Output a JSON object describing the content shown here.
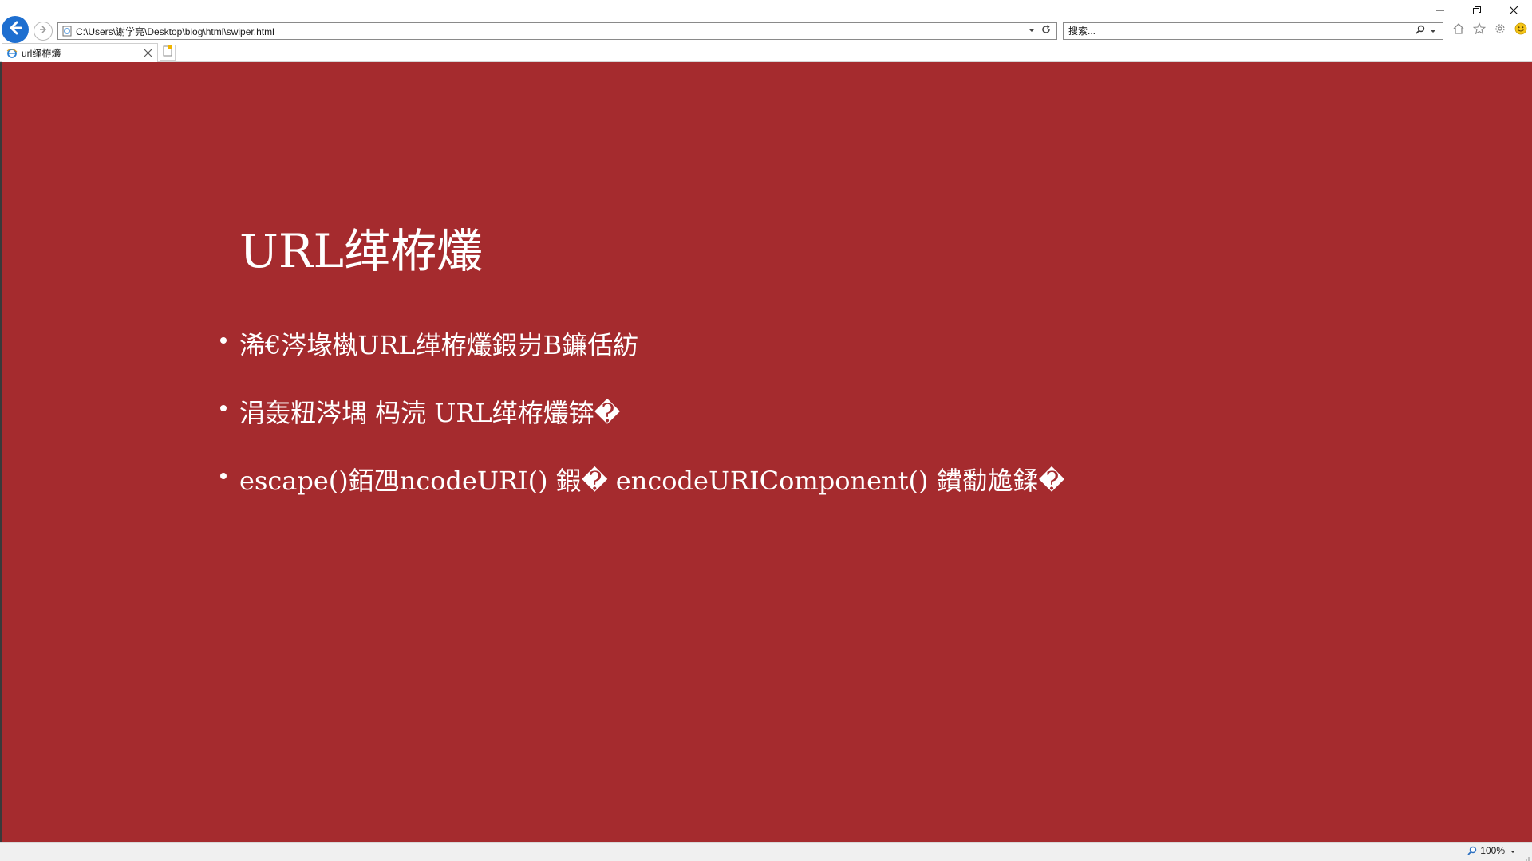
{
  "browser": {
    "address": "C:\\Users\\谢学亮\\Desktop\\blog\\html\\swiper.html",
    "search_placeholder": "搜索...",
    "tab_title": "url缂栫爜",
    "zoom": "100%"
  },
  "icons": {
    "back": "back-arrow-icon",
    "forward": "forward-arrow-icon",
    "page": "ie-page-icon",
    "dropdown": "chevron-down-icon",
    "refresh": "refresh-icon",
    "search": "magnifier-icon",
    "home": "home-icon",
    "favorites": "star-icon",
    "tools": "gear-icon",
    "feedback": "smiley-icon",
    "minimize": "minimize-icon",
    "restore": "restore-icon",
    "close": "close-icon",
    "new_tab": "new-tab-icon",
    "zoom": "zoom-magnifier-icon"
  },
  "colors": {
    "slide_background": "#a52b2e",
    "back_button": "#1e6fd0",
    "text": "#ffffff"
  },
  "slide": {
    "title": "URL缂栫爜",
    "bullets": [
      "浠€涔堟槸URL缂栫爜鍜岃В鐮佸紡",
      "涓轰粈涔堣  杩涜  URL缂栫爜锛�",
      "escape()銆乪ncodeURI() 鍜� encodeURIComponent() 鐨勫尯鍒�"
    ]
  }
}
